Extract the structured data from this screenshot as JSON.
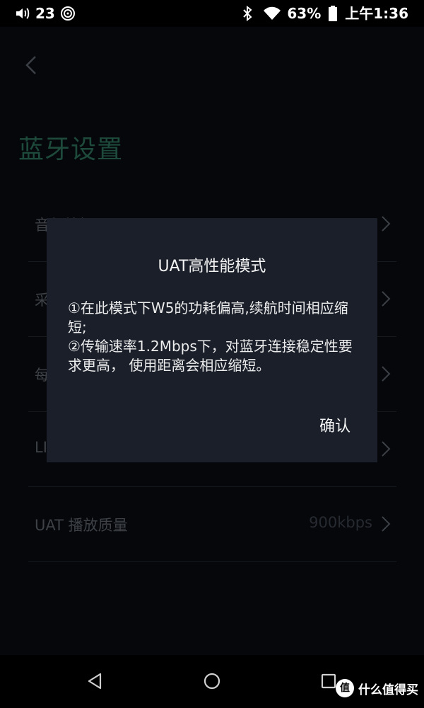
{
  "status_bar": {
    "volume_icon": "volume-icon",
    "volume_level": "23",
    "hires_icon": "hires-audio-icon",
    "bluetooth_icon": "bluetooth-icon",
    "wifi_icon": "wifi-icon",
    "battery_percent": "63%",
    "battery_icon": "battery-icon",
    "time": "上午1:36"
  },
  "page": {
    "back_icon": "chevron-left-icon",
    "title": "蓝牙设置",
    "rows": [
      {
        "label": "音频编解码器",
        "value": ""
      },
      {
        "label": "采",
        "value": ""
      },
      {
        "label": "每",
        "value": ""
      },
      {
        "label": "LI",
        "value": ""
      },
      {
        "label": "UAT 播放质量",
        "value": "900kbps"
      }
    ]
  },
  "dialog": {
    "title": "UAT高性能模式",
    "body_lines": [
      "①在此模式下W5的功耗偏高,续航时间相应缩短;",
      "②传输速率1.2Mbps下，对蓝牙连接稳定性要求更高， 使用距离会相应缩短。"
    ],
    "confirm_label": "确认"
  },
  "nav_bar": {
    "back_icon": "nav-back-icon",
    "home_icon": "nav-home-icon",
    "recents_icon": "nav-recents-icon"
  },
  "watermark": {
    "logo_text": "值",
    "text": "什么值得买"
  },
  "colors": {
    "dialog_bg": "#1a1f2a",
    "title_accent": "#1e4a3b",
    "screen_bg": "#05070b"
  }
}
